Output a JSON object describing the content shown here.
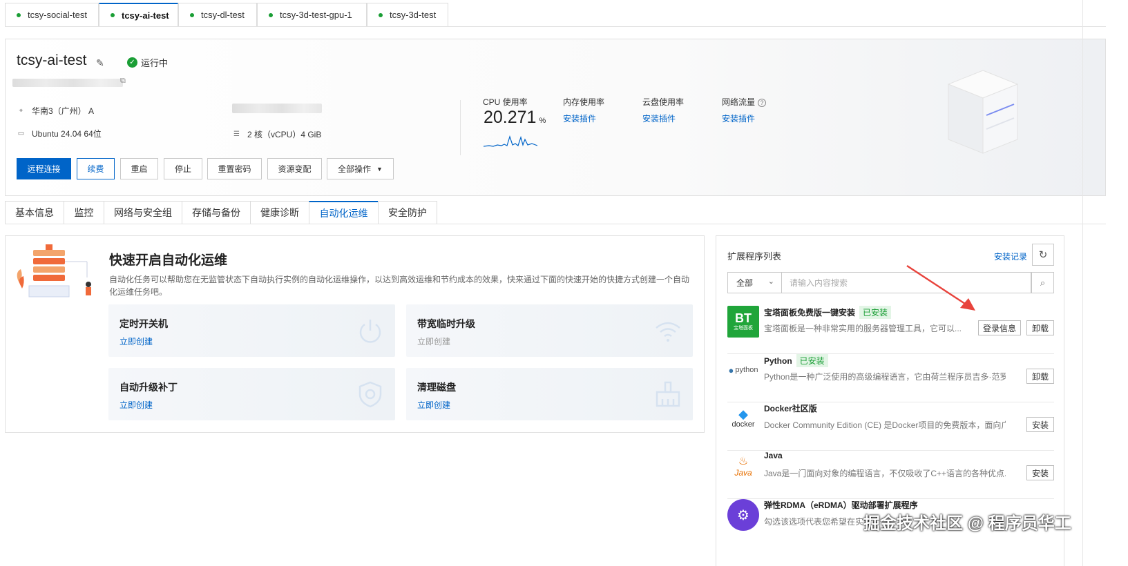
{
  "instance_tabs": [
    {
      "label": "tcsy-social-test"
    },
    {
      "label": "tcsy-ai-test"
    },
    {
      "label": "tcsy-dl-test"
    },
    {
      "label": "tcsy-3d-test-gpu-1"
    },
    {
      "label": "tcsy-3d-test"
    }
  ],
  "instance": {
    "name": "tcsy-ai-test",
    "status": "运行中",
    "region": "华南3（广州） A",
    "os": "Ubuntu 24.04 64位",
    "spec": "2 核（vCPU）4 GiB"
  },
  "actions": {
    "remote": "远程连接",
    "renew": "续费",
    "restart": "重启",
    "stop": "停止",
    "reset_pwd": "重置密码",
    "resize": "资源变配",
    "all_ops": "全部操作"
  },
  "metrics": {
    "cpu_label": "CPU 使用率",
    "cpu_value": "20.271",
    "cpu_unit": "%",
    "mem_label": "内存使用率",
    "disk_label": "云盘使用率",
    "net_label": "网络流量",
    "install_plugin": "安装插件"
  },
  "detail_tabs": [
    "基本信息",
    "监控",
    "网络与安全组",
    "存储与备份",
    "健康诊断",
    "自动化运维",
    "安全防护"
  ],
  "automation": {
    "title": "快速开启自动化运维",
    "desc": "自动化任务可以帮助您在无监管状态下自动执行实例的自动化运维操作，以达到高效运维和节约成本的效果，快来通过下面的快速开始的快捷方式创建一个自动化运维任务吧。",
    "tiles": [
      {
        "title": "定时开关机",
        "link": "立即创建",
        "icon": "power-icon"
      },
      {
        "title": "带宽临时升级",
        "link": "立即创建",
        "icon": "wifi-icon"
      },
      {
        "title": "自动升级补丁",
        "link": "立即创建",
        "icon": "shield-icon"
      },
      {
        "title": "清理磁盘",
        "link": "立即创建",
        "icon": "broom-icon"
      }
    ]
  },
  "extensions": {
    "title": "扩展程序列表",
    "log_link": "安装记录",
    "filter": "全部",
    "search_placeholder": "请输入内容搜索",
    "logo_bt_big": "BT",
    "logo_bt_small": "宝塔面板",
    "logo_python": "python",
    "logo_docker": "docker",
    "logo_java": "Java",
    "items": [
      {
        "name": "宝塔面板免费版一键安装",
        "badge": "已安装",
        "desc": "宝塔面板是一种非常实用的服务器管理工具，它可以...",
        "btn1": "登录信息",
        "btn2": "卸载"
      },
      {
        "name": "Python",
        "badge": "已安装",
        "desc": "Python是一种广泛使用的高级编程语言，它由荷兰程序员吉多·范罗...",
        "btn2": "卸载"
      },
      {
        "name": "Docker社区版",
        "desc": "Docker Community Edition (CE) 是Docker项目的免费版本，面向广...",
        "btn2": "安装"
      },
      {
        "name": "Java",
        "desc": "Java是一门面向对象的编程语言，不仅吸收了C++语言的各种优点...",
        "btn2": "安装"
      },
      {
        "name": "弹性RDMA（eRDMA）驱动部署扩展程序",
        "desc": "勾选该选项代表您希望在实例"
      }
    ]
  },
  "watermark": "掘金技术社区 @ 程序员华工",
  "colors": {
    "primary": "#0064c8",
    "success": "#1a9e35",
    "arrow": "#e8433c"
  }
}
